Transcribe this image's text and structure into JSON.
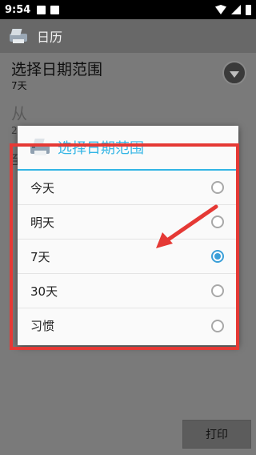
{
  "status_bar": {
    "time": "9:54"
  },
  "app_bar": {
    "title": "日历",
    "icon": "printer-icon"
  },
  "settings": {
    "range_title": "选择日期范围",
    "range_value": "7天",
    "from_label": "从",
    "from_value": "2",
    "to_label": "至"
  },
  "print_button": {
    "label": "打印"
  },
  "dialog": {
    "title": "选择日期范围",
    "icon": "printer-icon",
    "accent_color": "#33b5e5",
    "options": [
      {
        "label": "今天",
        "selected": false
      },
      {
        "label": "明天",
        "selected": false
      },
      {
        "label": "7天",
        "selected": true
      },
      {
        "label": "30天",
        "selected": false
      },
      {
        "label": "习惯",
        "selected": false
      }
    ]
  },
  "annotation": {
    "box_color": "#e53935",
    "arrow_color": "#e53935"
  }
}
